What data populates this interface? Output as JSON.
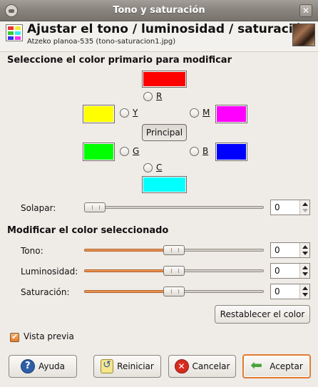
{
  "window": {
    "title": "Tono y saturación",
    "close_glyph": "✕"
  },
  "header": {
    "title": "Ajustar el tono / luminosidad / saturación",
    "subtitle": "Atzeko planoa-535 (tono-saturacion1.jpg)"
  },
  "primary_color": {
    "section_title": "Seleccione el color primario para modificar",
    "options": [
      {
        "key": "R",
        "label": "R",
        "color": "#ff0000"
      },
      {
        "key": "Y",
        "label": "Y",
        "color": "#ffff00"
      },
      {
        "key": "M",
        "label": "M",
        "color": "#ff00ff"
      },
      {
        "key": "G",
        "label": "G",
        "color": "#00ff00"
      },
      {
        "key": "B",
        "label": "B",
        "color": "#0000ff"
      },
      {
        "key": "C",
        "label": "C",
        "color": "#00ffff"
      }
    ],
    "master_button": "Principal",
    "overlap": {
      "label": "Solapar:",
      "value": "0"
    }
  },
  "modify": {
    "section_title": "Modificar el color seleccionado",
    "hue": {
      "label": "Tono:",
      "value": "0"
    },
    "lightness": {
      "label": "Luminosidad:",
      "value": "0"
    },
    "saturation": {
      "label": "Saturación:",
      "value": "0"
    },
    "reset_color_button": "Restablecer el color"
  },
  "preview": {
    "label": "Vista previa",
    "checked": true
  },
  "buttons": {
    "help": "Ayuda",
    "reset": "Reiniciar",
    "cancel": "Cancelar",
    "ok": "Aceptar"
  },
  "icons": {
    "help": "help-icon",
    "reset": "reset-icon",
    "cancel": "cancel-icon",
    "ok": "ok-icon"
  }
}
